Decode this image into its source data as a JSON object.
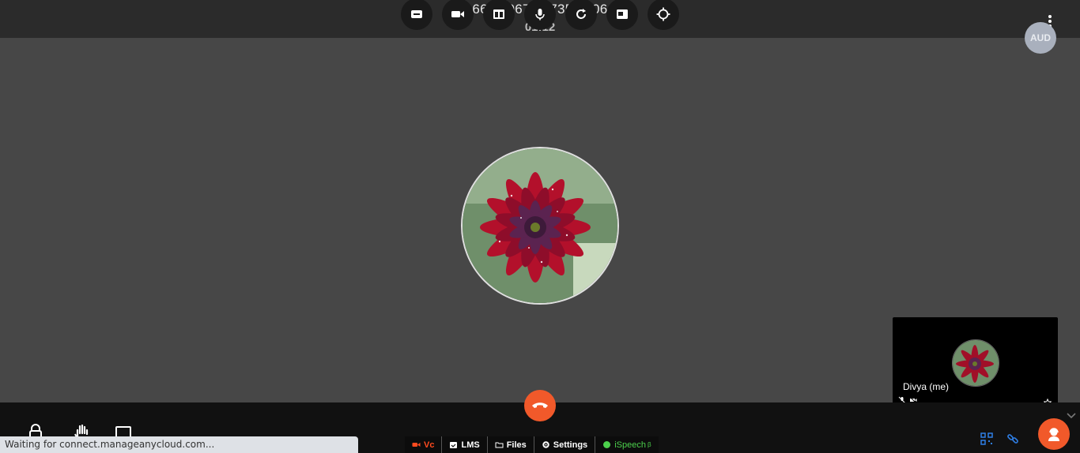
{
  "header": {
    "meeting_id": "6610 0670 8735 3806",
    "timer": "01:12",
    "tools": [
      "whiteboard-icon",
      "video-icon",
      "layout-icon",
      "microphone-icon",
      "refresh-icon",
      "screen-share-icon",
      "target-icon"
    ],
    "aud_badge": "AUD"
  },
  "self_view": {
    "name": "Divya (me)"
  },
  "bottom_tabs": [
    {
      "label": "Vc",
      "icon": "video-icon",
      "color": "#ff4b1f"
    },
    {
      "label": "LMS",
      "icon": "calendar-check-icon"
    },
    {
      "label": "Files",
      "icon": "folder-icon"
    },
    {
      "label": "Settings",
      "icon": "gear-icon"
    },
    {
      "label": "iSpeech",
      "icon": "green-dot-icon",
      "sup": "β",
      "color": "#4cd04c"
    }
  ],
  "status_bar": {
    "text": "Waiting for connect.manageanycloud.com..."
  },
  "colors": {
    "accent": "#f1592a",
    "stage_bg": "#474747",
    "topbar_bg": "#2b2b2b"
  }
}
